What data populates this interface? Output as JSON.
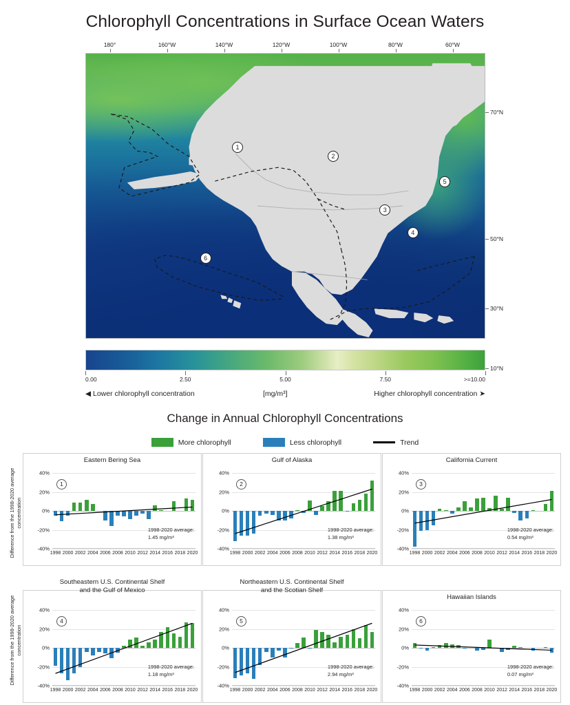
{
  "page": {
    "main_title": "Chlorophyll Concentrations in Surface Ocean Waters",
    "lower_title": "Change in Annual Chlorophyll Concentrations"
  },
  "map": {
    "lon_labels": [
      "180°",
      "160°W",
      "140°W",
      "120°W",
      "100°W",
      "80°W",
      "60°W"
    ],
    "lat_labels": [
      "70°N",
      "50°N",
      "30°N",
      "10°N"
    ],
    "markers": [
      {
        "id": "1",
        "x": 38,
        "y": 33
      },
      {
        "id": "2",
        "x": 62,
        "y": 36
      },
      {
        "id": "3",
        "x": 75,
        "y": 55
      },
      {
        "id": "4",
        "x": 82,
        "y": 63
      },
      {
        "id": "5",
        "x": 90,
        "y": 45
      },
      {
        "id": "6",
        "x": 30,
        "y": 72
      }
    ]
  },
  "colorbar": {
    "ticks": [
      "0.00",
      "2.50",
      "5.00",
      "7.50",
      ">=10.00"
    ],
    "left_caption": "◀ Lower chlorophyll concentration",
    "center_caption": "[mg/m³]",
    "right_caption": "Higher chlorophyll concentration ➤"
  },
  "legend": {
    "more_label": "More chlorophyll",
    "less_label": "Less chlorophyll",
    "trend_label": "Trend",
    "more_color": "#3aa03a",
    "less_color": "#2a7fba",
    "trend_color": "#000000"
  },
  "axis": {
    "y_label": "Difference from the 1998-2020 average concentration",
    "y_ticks": [
      "40%",
      "20%",
      "0%",
      "-20%",
      "-40%"
    ],
    "y_min": -40,
    "y_max": 40,
    "x_ticks": [
      "1998",
      "2000",
      "2002",
      "2004",
      "2006",
      "2008",
      "2010",
      "2012",
      "2014",
      "2016",
      "2018",
      "2020"
    ]
  },
  "chart_data": {
    "type": "bar",
    "title": "Change in Annual Chlorophyll Concentrations",
    "xlabel": "",
    "ylabel": "Difference from the 1998-2020 average concentration",
    "ylim": [
      -40,
      40
    ],
    "grid": true,
    "legend_position": "top-center",
    "x": [
      1998,
      1999,
      2000,
      2001,
      2002,
      2003,
      2004,
      2005,
      2006,
      2007,
      2008,
      2009,
      2010,
      2011,
      2012,
      2013,
      2014,
      2015,
      2016,
      2017,
      2018,
      2019,
      2020
    ],
    "panels": [
      {
        "number": "1",
        "title": "Eastern Bering Sea",
        "average_label": "1998-2020 average:",
        "average_value": "1.45 mg/m³",
        "values": [
          -5,
          -11,
          -5,
          9,
          9,
          12,
          7,
          0,
          -10,
          -16,
          -5,
          -6,
          -9,
          -5,
          -3,
          -9,
          6,
          1,
          0,
          10,
          0,
          13,
          12
        ],
        "trend": [
          -4.2,
          4.0
        ]
      },
      {
        "number": "2",
        "title": "Gulf of Alaska",
        "average_label": "1998-2020 average:",
        "average_value": "1.38 mg/m³",
        "values": [
          -32,
          -26,
          -26,
          -24,
          -5,
          -3,
          -4,
          -10,
          -10,
          -8,
          1,
          -2,
          11,
          -4,
          5,
          10,
          21,
          21,
          -1,
          8,
          12,
          18,
          32
        ],
        "trend": [
          -24.0,
          23.0
        ]
      },
      {
        "number": "3",
        "title": "California Current",
        "average_label": "1998-2020 average:",
        "average_value": "0.54 mg/m³",
        "values": [
          -38,
          -21,
          -20,
          -15,
          2,
          1,
          -3,
          4,
          10,
          4,
          13,
          14,
          3,
          16,
          2,
          14,
          -2,
          -10,
          -8,
          1,
          0,
          7,
          21
        ],
        "trend": [
          -13.0,
          12.0
        ]
      },
      {
        "number": "4",
        "title": "Southeastern U.S. Continental Shelf and the Gulf of Mexico",
        "title_line1": "Southeastern U.S. Continental Shelf",
        "title_line2": "and the Gulf of Mexico",
        "average_label": "1998-2020 average:",
        "average_value": "1.18 mg/m³",
        "values": [
          -19,
          -27,
          -34,
          -27,
          -20,
          -4,
          -8,
          -4,
          -6,
          -11,
          -5,
          2,
          9,
          11,
          2,
          6,
          9,
          17,
          22,
          15,
          12,
          27,
          26
        ],
        "trend": [
          -27.0,
          26.0
        ]
      },
      {
        "number": "5",
        "title": "Northeastern U.S. Continental Shelf and the Scotian Shelf",
        "title_line1": "Northeastern U.S. Continental Shelf",
        "title_line2": "and the Scotian Shelf",
        "average_label": "1998-2020 average:",
        "average_value": "2.94 mg/m³",
        "values": [
          -32,
          -29,
          -27,
          -33,
          -18,
          -4,
          -10,
          -3,
          -10,
          -1,
          5,
          11,
          -1,
          19,
          17,
          14,
          6,
          12,
          14,
          20,
          10,
          24,
          17
        ],
        "trend": [
          -26.0,
          26.0
        ]
      },
      {
        "number": "6",
        "title": "Hawaiian Islands",
        "average_label": "1998-2020 average:",
        "average_value": "0.07 mg/m³",
        "values": [
          5,
          -1,
          -3,
          1,
          3,
          5,
          4,
          3,
          -1,
          0,
          -3,
          -2,
          9,
          0,
          -4,
          -2,
          2,
          1,
          0,
          -3,
          0,
          1,
          -5,
          0
        ],
        "trend": [
          3.0,
          -2.5
        ]
      }
    ]
  }
}
